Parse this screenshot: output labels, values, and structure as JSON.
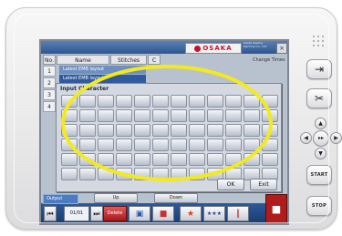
{
  "device": {
    "hardware_buttons": {
      "nav_icon": "arrow-right-into-box-icon",
      "tool_icon": "scissors-icon",
      "start_label": "START",
      "stop_label": "STOP",
      "dpad_center_label": "▸▸",
      "dpad_up": "▲",
      "dpad_down": "▼",
      "dpad_left": "◀",
      "dpad_right": "▶"
    }
  },
  "screen": {
    "brand": "OSAKA",
    "brand_color": "#c8102e",
    "company_text": "Osaka Sewing Machine Co., Ltd.",
    "close_icon": "×",
    "columns": [
      "No.",
      "Name",
      "Stitches",
      "C"
    ],
    "row_numbers": [
      "1",
      "2",
      "3",
      "4"
    ],
    "change_times_label": "Change Times",
    "dropdown_items": [
      "Latest EMB layout",
      "Latest EMB layout"
    ],
    "dialog": {
      "title": "Input Character",
      "ok_label": "OK",
      "exit_label": "Exit"
    },
    "mid_buttons": [
      "Up",
      "Down"
    ],
    "output_tab_label": "Output",
    "page_indicator": "01/01",
    "first_icon": "⏮",
    "last_icon": "⏭",
    "delete_label": "Delete",
    "accent_color": "#2c5a9c",
    "highlight_color": "#f3ea1c"
  }
}
